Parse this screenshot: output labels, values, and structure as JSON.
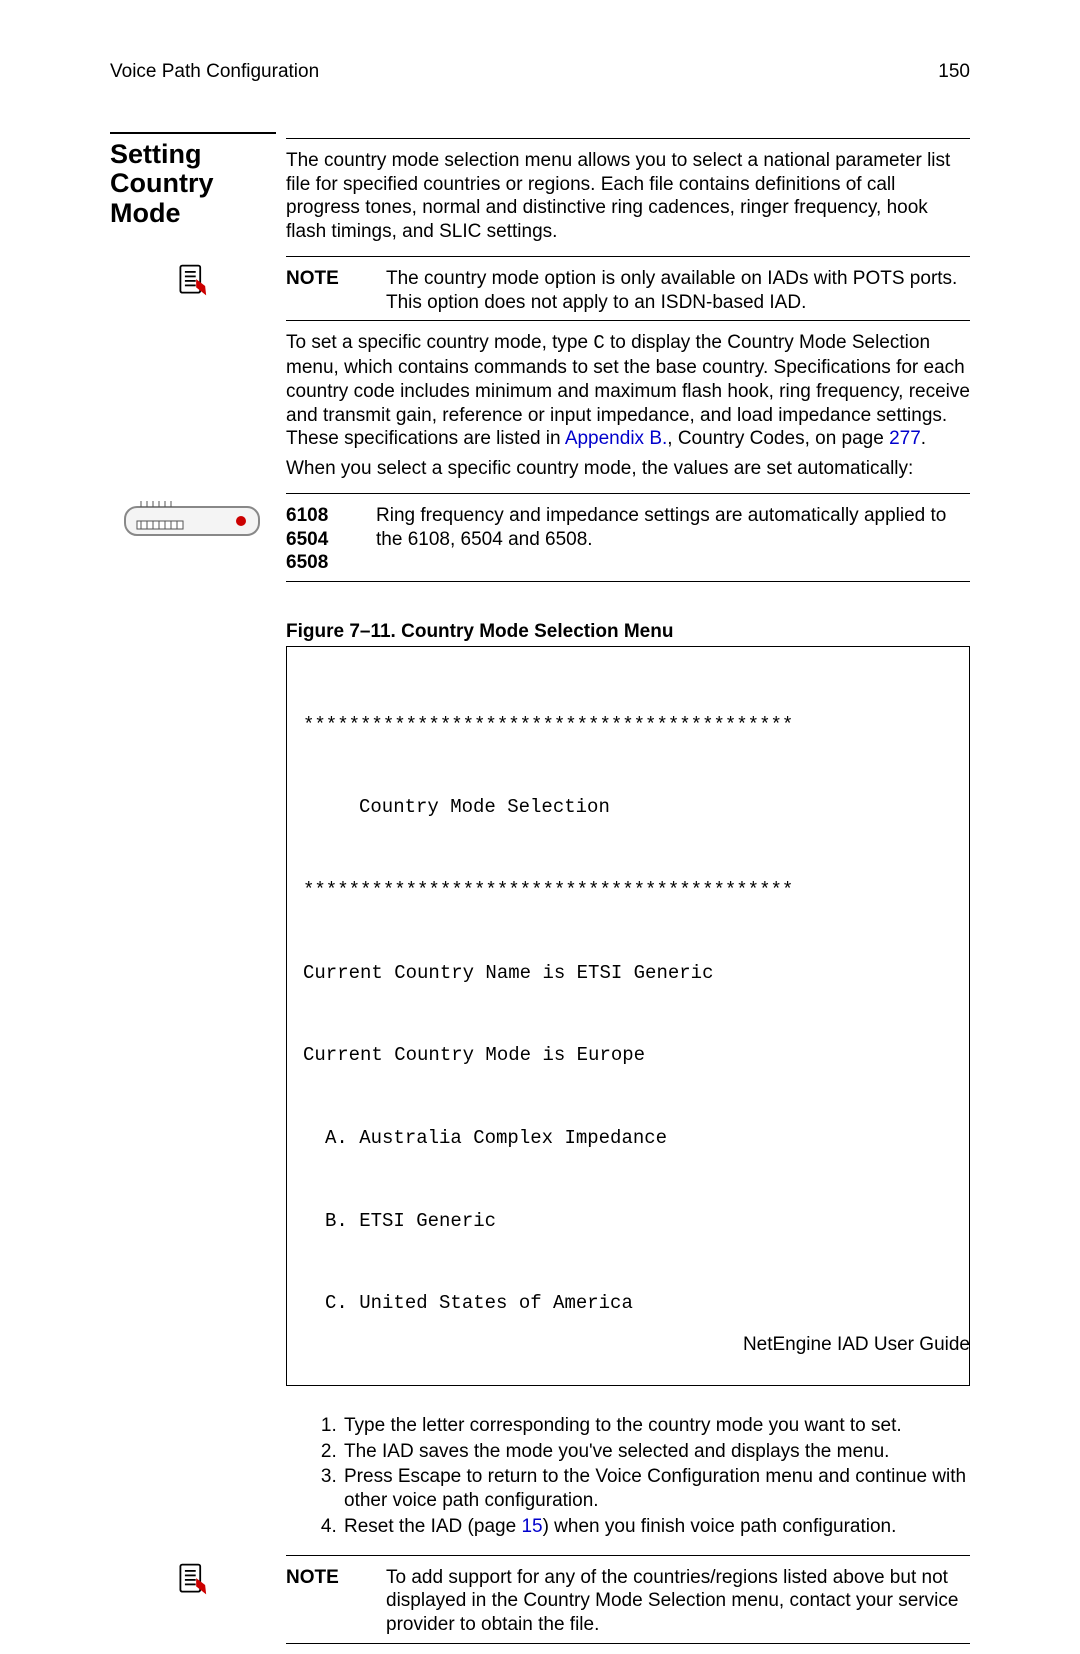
{
  "header": {
    "left": "Voice Path Configuration",
    "right": "150"
  },
  "section_title": "Setting Country Mode",
  "icons": {
    "note": "note-icon",
    "device": "device-icon"
  },
  "intro": "The country mode selection menu allows you to select a national parameter list file for specified countries or regions. Each file contains definitions of call progress tones, normal and distinctive ring cadences, ringer frequency, hook flash timings, and SLIC settings.",
  "note1": {
    "label": "NOTE",
    "text": "The country mode option is only available on IADs with POTS ports. This option does not apply to an ISDN-based IAD."
  },
  "para2_pre": "To set a specific country mode, type ",
  "para2_key": "C",
  "para2_mid": " to display the Country Mode Selection menu, which contains commands to set the base country. Specifications for each country code includes minimum and maximum flash hook, ring frequency, receive and transmit gain, reference or input impedance, and load impedance settings. These specifications are listed in ",
  "para2_link": "Appendix B.",
  "para2_post1": ", Country Codes, on page ",
  "para2_page": "277",
  "para2_end": ".",
  "para3": "When you select a specific country mode, the values are set automatically:",
  "models": {
    "list": [
      "6108",
      "6504",
      "6508"
    ],
    "l1": "6108",
    "l2": "6504",
    "l3": "6508",
    "text": "Ring frequency and impedance settings are automatically applied to the 6108, 6504 and 6508."
  },
  "figure_caption": "Figure 7–11.  Country Mode Selection Menu",
  "terminal": {
    "stars": "*******************************************",
    "title": "Country Mode Selection",
    "line1": "Current Country Name is ETSI Generic",
    "line2": "Current Country Mode is Europe",
    "optA": "A. Australia Complex Impedance",
    "optB": "B. ETSI Generic",
    "optC": "C. United States of America"
  },
  "steps": {
    "s1": "Type the letter corresponding to the country mode you want to set.",
    "s2": "The IAD saves the mode you've selected and displays the menu.",
    "s3": "Press Escape to return to the Voice Configuration menu and continue with other voice path configuration.",
    "s4_pre": "Reset the IAD (page ",
    "s4_page": "15",
    "s4_post": ") when you finish voice path configuration."
  },
  "note2": {
    "label": "NOTE",
    "text": "To add support for any of the countries/regions listed above but not displayed in the Country Mode Selection menu, contact your service provider to obtain the file."
  },
  "footer": "NetEngine IAD User Guide",
  "colors": {
    "link": "#0000cc"
  }
}
